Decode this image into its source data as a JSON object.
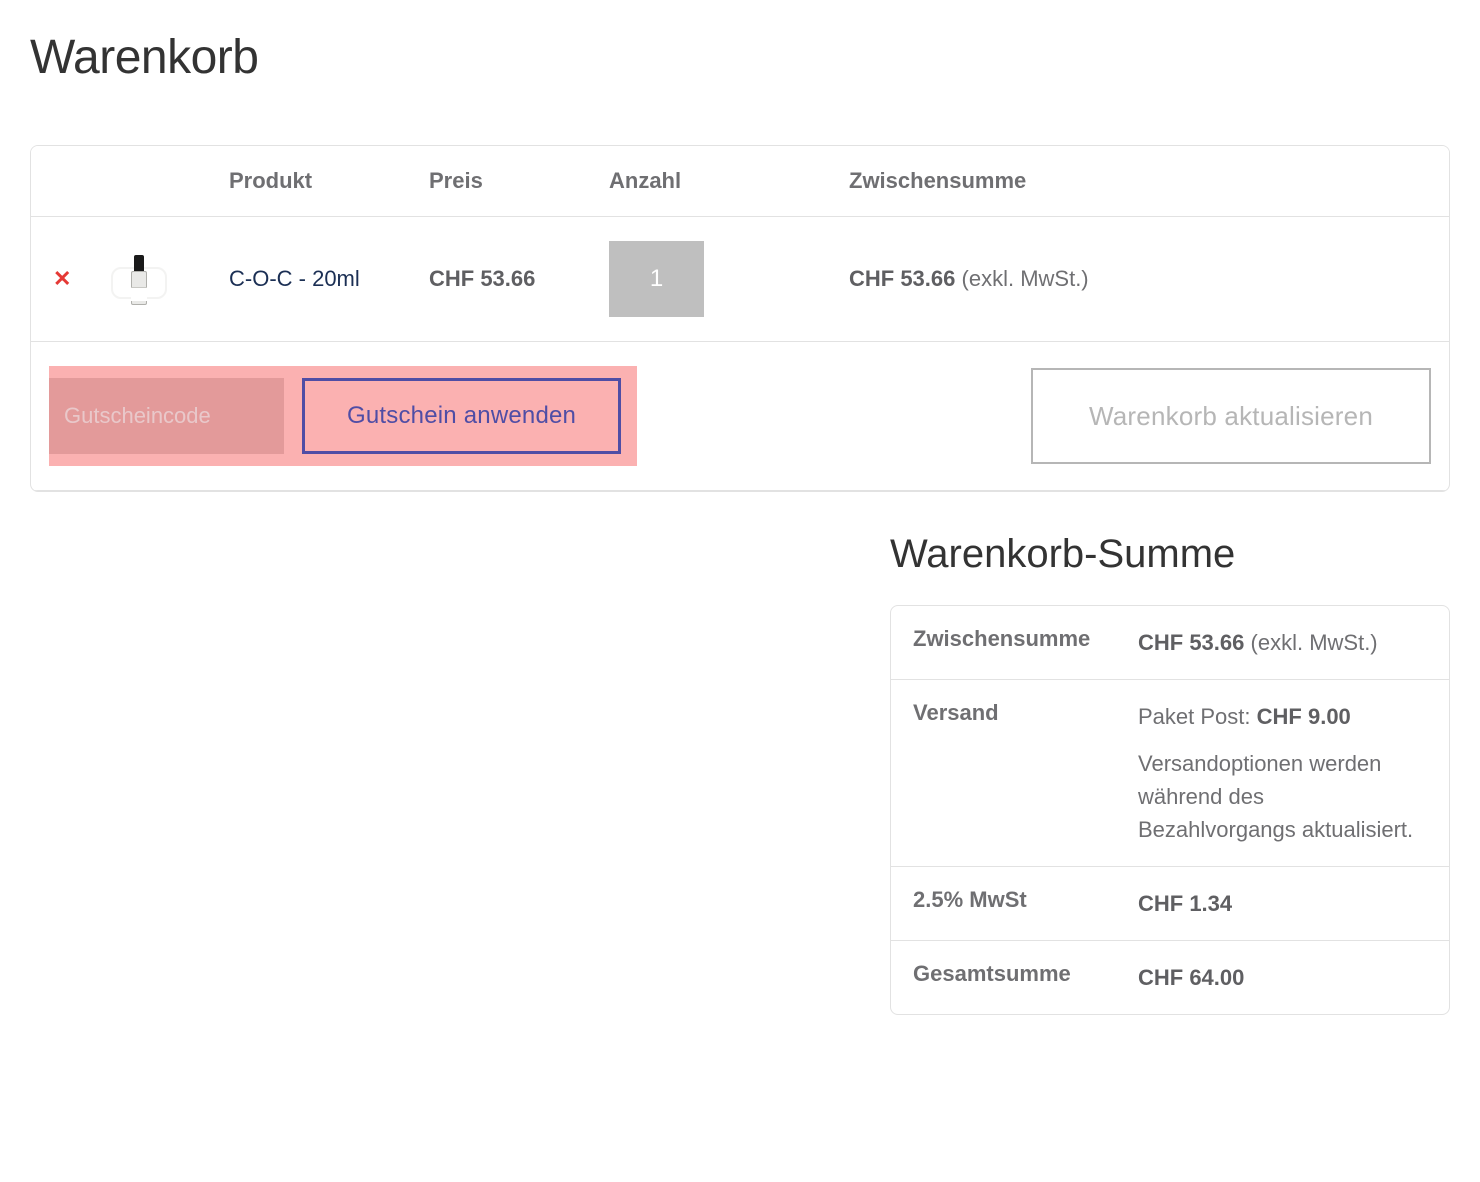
{
  "page": {
    "title": "Warenkorb"
  },
  "cart": {
    "headers": {
      "product": "Produkt",
      "price": "Preis",
      "quantity": "Anzahl",
      "subtotal": "Zwischensumme"
    },
    "items": [
      {
        "name": "C-O-C - 20ml",
        "price": "CHF 53.66",
        "quantity": "1",
        "subtotal": "CHF 53.66",
        "tax_note": "(exkl. MwSt.)"
      }
    ],
    "coupon": {
      "placeholder": "Gutscheincode",
      "apply_label": "Gutschein anwenden"
    },
    "update_label": "Warenkorb aktualisieren"
  },
  "totals": {
    "title": "Warenkorb-Summe",
    "rows": {
      "subtotal": {
        "label": "Zwischensumme",
        "amount": "CHF 53.66",
        "tax_note": "(exkl. MwSt.)"
      },
      "shipping": {
        "label": "Versand",
        "method": "Paket Post:",
        "amount": "CHF 9.00",
        "note": "Versandoptionen werden während des Bezahlvorgangs aktualisiert."
      },
      "tax": {
        "label": "2.5% MwSt",
        "amount": "CHF 1.34"
      },
      "total": {
        "label": "Gesamtsumme",
        "amount": "CHF 64.00"
      }
    }
  }
}
